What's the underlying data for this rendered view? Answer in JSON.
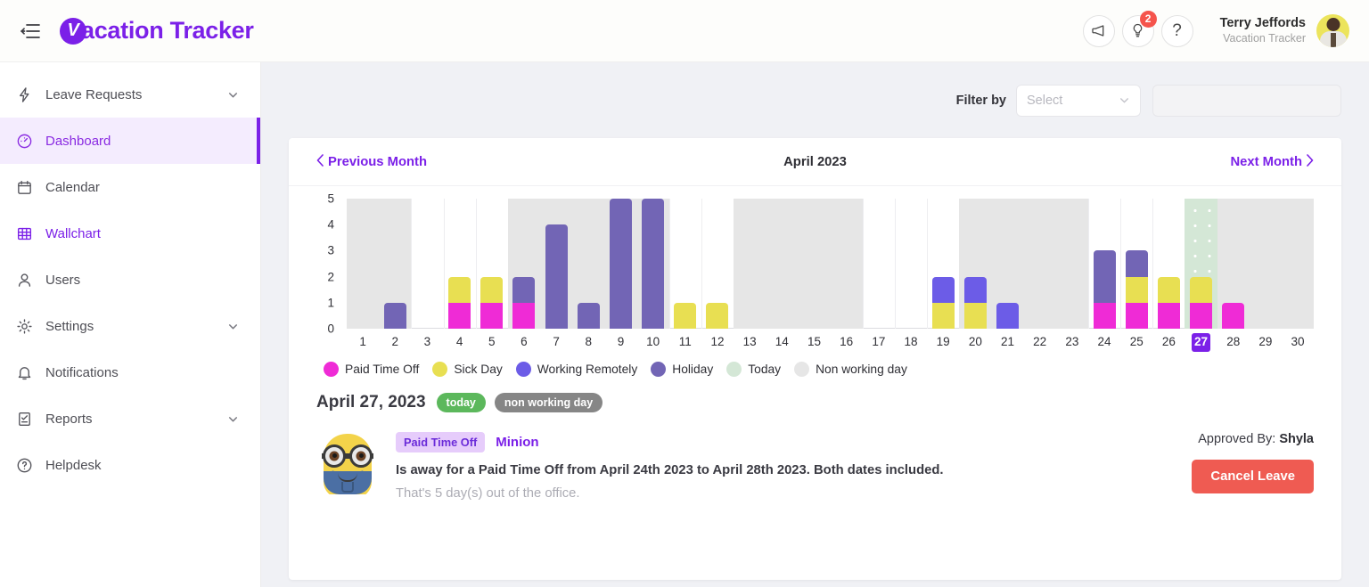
{
  "header": {
    "menu_icon": "hamburger-menu-icon",
    "brand_mark": "V",
    "brand_text": "acation Tracker",
    "announce_icon": "megaphone-icon",
    "ideas_icon": "lightbulb-icon",
    "ideas_badge": "2",
    "help_icon": "question-mark-icon",
    "user_name": "Terry Jeffords",
    "user_org": "Vacation Tracker"
  },
  "sidebar": {
    "items": [
      {
        "label": "Leave Requests",
        "icon": "bolt-icon",
        "chevron": true,
        "state": "default"
      },
      {
        "label": "Dashboard",
        "icon": "speedometer-icon",
        "chevron": false,
        "state": "active"
      },
      {
        "label": "Calendar",
        "icon": "calendar-icon",
        "chevron": false,
        "state": "default"
      },
      {
        "label": "Wallchart",
        "icon": "grid-table-icon",
        "chevron": false,
        "state": "purple"
      },
      {
        "label": "Users",
        "icon": "user-icon",
        "chevron": false,
        "state": "default"
      },
      {
        "label": "Settings",
        "icon": "gear-icon",
        "chevron": true,
        "state": "default"
      },
      {
        "label": "Notifications",
        "icon": "bell-icon",
        "chevron": false,
        "state": "default"
      },
      {
        "label": "Reports",
        "icon": "report-icon",
        "chevron": true,
        "state": "default"
      },
      {
        "label": "Helpdesk",
        "icon": "help-circle-icon",
        "chevron": false,
        "state": "default"
      }
    ]
  },
  "filter": {
    "label": "Filter by",
    "select_placeholder": "Select",
    "select_value": "",
    "text_value": "",
    "text_placeholder": ""
  },
  "month_nav": {
    "previous": "Previous Month",
    "title": "April 2023",
    "next": "Next Month"
  },
  "chart_data": {
    "type": "bar",
    "title": "April 2023",
    "xlabel": "",
    "ylabel": "",
    "ylim": [
      0,
      5
    ],
    "yticks": [
      0,
      1,
      2,
      3,
      4,
      5
    ],
    "grid": false,
    "stacked": true,
    "legend_position": "bottom-left",
    "categories": [
      "1",
      "2",
      "3",
      "4",
      "5",
      "6",
      "7",
      "8",
      "9",
      "10",
      "11",
      "12",
      "13",
      "14",
      "15",
      "16",
      "17",
      "18",
      "19",
      "20",
      "21",
      "22",
      "23",
      "24",
      "25",
      "26",
      "27",
      "28",
      "29",
      "30"
    ],
    "series": [
      {
        "name": "Paid Time Off",
        "color": "#ef2bd6",
        "values": [
          0,
          0,
          0,
          1,
          1,
          1,
          0,
          0,
          0,
          0,
          0,
          0,
          0,
          0,
          0,
          0,
          0,
          0,
          0,
          0,
          0,
          0,
          0,
          1,
          1,
          1,
          1,
          1,
          0,
          0
        ]
      },
      {
        "name": "Sick Day",
        "color": "#e8df52",
        "values": [
          0,
          0,
          0,
          1,
          1,
          0,
          0,
          0,
          0,
          0,
          1,
          1,
          0,
          0,
          0,
          0,
          0,
          0,
          1,
          1,
          0,
          0,
          0,
          0,
          1,
          1,
          1,
          0,
          0,
          0
        ]
      },
      {
        "name": "Working Remotely",
        "color": "#6c5ce7",
        "values": [
          0,
          0,
          0,
          0,
          0,
          0,
          0,
          0,
          0,
          0,
          0,
          0,
          0,
          0,
          0,
          0,
          0,
          0,
          1,
          1,
          1,
          0,
          0,
          0,
          0,
          0,
          0,
          0,
          0,
          0
        ]
      },
      {
        "name": "Holiday",
        "color": "#7265b5",
        "values": [
          0,
          1,
          0,
          0,
          0,
          1,
          4,
          1,
          5,
          5,
          0,
          0,
          0,
          0,
          0,
          0,
          0,
          0,
          0,
          0,
          0,
          0,
          0,
          2,
          1,
          0,
          0,
          0,
          0,
          0
        ]
      }
    ],
    "column_background": [
      "nonworking",
      "nonworking",
      "normal",
      "normal",
      "normal",
      "nonworking",
      "nonworking",
      "nonworking",
      "nonworking",
      "nonworking",
      "normal",
      "normal",
      "nonworking",
      "nonworking",
      "nonworking",
      "nonworking",
      "normal",
      "normal",
      "normal",
      "nonworking",
      "nonworking",
      "nonworking",
      "nonworking",
      "normal",
      "normal",
      "normal",
      "today",
      "nonworking",
      "nonworking",
      "nonworking"
    ],
    "today_index": 26,
    "legend": [
      {
        "label": "Paid Time Off",
        "color": "#ef2bd6"
      },
      {
        "label": "Sick Day",
        "color": "#e8df52"
      },
      {
        "label": "Working Remotely",
        "color": "#6c5ce7"
      },
      {
        "label": "Holiday",
        "color": "#7265b5"
      },
      {
        "label": "Today",
        "color": "#d4e7d6"
      },
      {
        "label": "Non working day",
        "color": "#e6e6e6"
      }
    ]
  },
  "day_detail": {
    "title": "April 27, 2023",
    "badges": [
      {
        "label": "today",
        "kind": "today"
      },
      {
        "label": "non working day",
        "kind": "nonworking"
      }
    ],
    "request": {
      "avatar": "minion-avatar",
      "type_badge": "Paid Time Off",
      "user": "Minion",
      "text": "Is away for a Paid Time Off from April 24th 2023 to April 28th 2023. Both dates included.",
      "subtext": "That's 5 day(s) out of the office.",
      "approved_prefix": "Approved By: ",
      "approved_by": "Shyla",
      "cancel_label": "Cancel Leave"
    }
  }
}
